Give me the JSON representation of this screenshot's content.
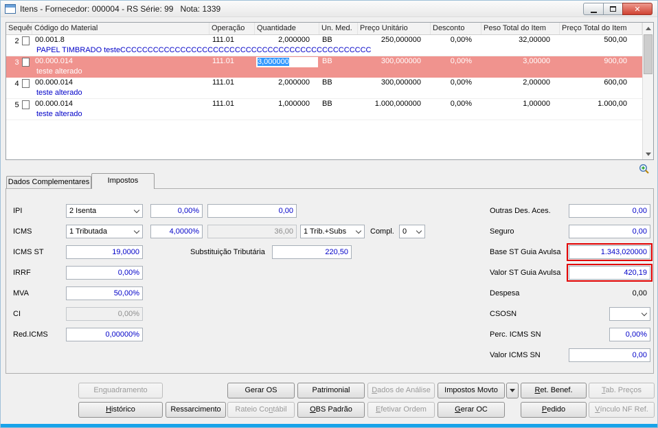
{
  "window": {
    "title": "Itens - Fornecedor: 000004 - RS Série: 99   Nota: 1339"
  },
  "icons": {
    "close": "✕",
    "minimize": "minimize-glyph",
    "maximize": "maximize-glyph",
    "combo_arrow": "chevron-down",
    "zoom": "magnifier-zoom-in"
  },
  "grid": {
    "columns": [
      "Sequência",
      "Código do Material",
      "Operação",
      "Quantidade",
      "Un. Med.",
      "Preço Unitário",
      "Desconto",
      "Peso Total do Item",
      "Preço Total do Item"
    ],
    "rows": [
      {
        "seq": "2",
        "codigo": "00.001.8",
        "operacao": "111.01",
        "quantidade": "2,000000",
        "un_med": "BB",
        "preco_unitario": "250,000000",
        "desconto": "0,00%",
        "peso_total": "32,00000",
        "preco_total": "500,00",
        "descricao": "PAPEL TIMBRADO testeCCCCCCCCCCCCCCCCCCCCCCCCCCCCCCCCCCCCCCCCCCCCCC",
        "selected": false
      },
      {
        "seq": "3",
        "codigo": "00.000.014",
        "operacao": "111.01",
        "quantidade": "3,000000",
        "un_med": "BB",
        "preco_unitario": "300,000000",
        "desconto": "0,00%",
        "peso_total": "3,00000",
        "preco_total": "900,00",
        "descricao": "teste alterado",
        "selected": true
      },
      {
        "seq": "4",
        "codigo": "00.000.014",
        "operacao": "111.01",
        "quantidade": "2,000000",
        "un_med": "BB",
        "preco_unitario": "300,000000",
        "desconto": "0,00%",
        "peso_total": "2,00000",
        "preco_total": "600,00",
        "descricao": "teste alterado",
        "selected": false
      },
      {
        "seq": "5",
        "codigo": "00.000.014",
        "operacao": "111.01",
        "quantidade": "1,000000",
        "un_med": "BB",
        "preco_unitario": "1.000,000000",
        "desconto": "0,00%",
        "peso_total": "1,00000",
        "preco_total": "1.000,00",
        "descricao": "teste alterado",
        "selected": false
      }
    ]
  },
  "tabs": [
    {
      "label": "Dados Complementares",
      "active": false
    },
    {
      "label": "Impostos",
      "active": true
    }
  ],
  "form": {
    "ipi": {
      "label": "IPI",
      "tipo": "2 Isenta",
      "aliquota": "0,00%",
      "valor": "0,00"
    },
    "icms": {
      "label": "ICMS",
      "tipo": "1 Tributada",
      "aliquota": "4,0000%",
      "valor": "36,00",
      "tributacao": "1 Trib.+Subs",
      "compl_label": "Compl.",
      "compl": "0"
    },
    "icms_st": {
      "label": "ICMS ST",
      "valor": "19,0000"
    },
    "subst_trib": {
      "label": "Substituição Tributária",
      "valor": "220,50"
    },
    "irrf": {
      "label": "IRRF",
      "valor": "0,00%"
    },
    "mva": {
      "label": "MVA",
      "valor": "50,00%"
    },
    "ci": {
      "label": "CI",
      "valor": "0,00%"
    },
    "red_icms": {
      "label": "Red.ICMS",
      "valor": "0,00000%"
    },
    "outras_des": {
      "label": "Outras Des. Aces.",
      "valor": "0,00"
    },
    "seguro": {
      "label": "Seguro",
      "valor": "0,00"
    },
    "base_st": {
      "label": "Base ST Guia Avulsa",
      "valor": "1.343,020000"
    },
    "valor_st": {
      "label": "Valor ST Guia Avulsa",
      "valor": "420,19"
    },
    "despesa": {
      "label": "Despesa",
      "valor": "0,00"
    },
    "csosn": {
      "label": "CSOSN",
      "valor": ""
    },
    "perc_icms_sn": {
      "label": "Perc. ICMS SN",
      "valor": "0,00%"
    },
    "valor_icms_sn": {
      "label": "Valor ICMS SN",
      "valor": "0,00"
    }
  },
  "buttons": {
    "row1": [
      {
        "label": "Enquadramento",
        "underline": 2,
        "enabled": false
      },
      {
        "label": "Gerar OS",
        "underline": -1,
        "enabled": true
      },
      {
        "label": "Patrimonial",
        "underline": -1,
        "enabled": true
      },
      {
        "label": "Dados de Análise",
        "underline": 0,
        "enabled": false
      },
      {
        "label": "Impostos Movto",
        "underline": -1,
        "enabled": true
      },
      {
        "label": "dropdown-arrow",
        "underline": -1,
        "enabled": true
      },
      {
        "label": "Ret. Benef.",
        "underline": 0,
        "enabled": true
      },
      {
        "label": "Tab. Preços",
        "underline": 0,
        "enabled": false
      }
    ],
    "row2": [
      {
        "label": "Histórico",
        "underline": 0,
        "enabled": true
      },
      {
        "label": "Ressarcimento",
        "underline": -1,
        "enabled": true
      },
      {
        "label": "Rateio Contábil",
        "underline": 9,
        "enabled": false
      },
      {
        "label": "OBS Padrão",
        "underline": 0,
        "enabled": true
      },
      {
        "label": "Efetivar Ordem",
        "underline": 0,
        "enabled": false
      },
      {
        "label": "Gerar OC",
        "underline": 0,
        "enabled": true
      },
      {
        "label": "Pedido",
        "underline": 0,
        "enabled": true
      },
      {
        "label": "Vínculo NF Ref.",
        "underline": 0,
        "enabled": false
      }
    ]
  },
  "colors": {
    "selected_row": "#F0938E",
    "description_text": "#0000C8",
    "field_value_text": "#0000C8",
    "edit_selection": "#3399FF",
    "highlight_border": "#E10000",
    "bottom_strip": "#18A3E9"
  }
}
